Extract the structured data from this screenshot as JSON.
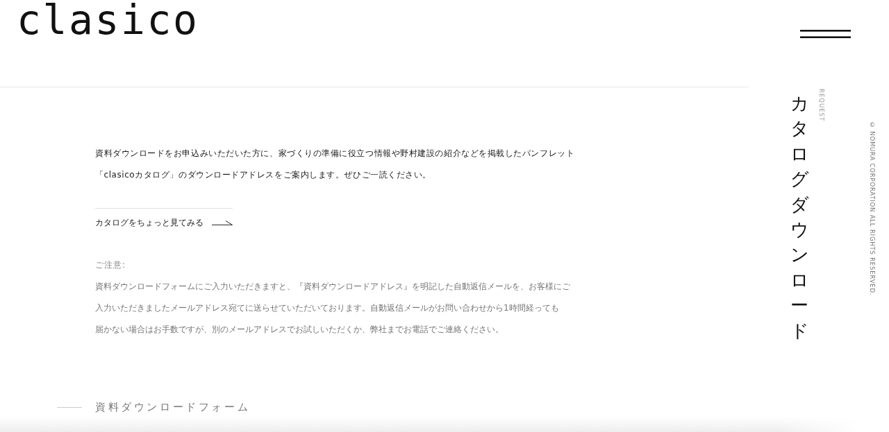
{
  "header": {
    "logo": "clasico"
  },
  "side": {
    "title": "カタログダウンロード",
    "label": "REQUEST",
    "copyright": "© NOMURA CORPORATION ALL RIGHTS RESERVED."
  },
  "intro": {
    "lines": [
      "資料ダウンロードをお申込みいただいた方に、家づくりの準備に役立つ情報や野村建設の紹介などを掲載したパンフレット",
      "「clasicoカタログ」のダウンロードアドレスをご案内します。ぜひご一読ください。"
    ]
  },
  "catalog_link": {
    "label": "カタログをちょっと見てみる"
  },
  "notice": {
    "heading": "ご注意:",
    "lines": [
      "資料ダウンロードフォームにご入力いただきますと、『資料ダウンロードアドレス』を明記した自動返信メールを、お客様にご",
      "入力いただきましたメールアドレス宛てに送らせていただいております。自動返信メールがお問い合わせから1時間経っても",
      "届かない場合はお手数ですが、別のメールアドレスでお試しいただくか、弊社までお電話でご連絡ください。"
    ]
  },
  "form_section": {
    "heading": "資料ダウンロードフォーム"
  }
}
